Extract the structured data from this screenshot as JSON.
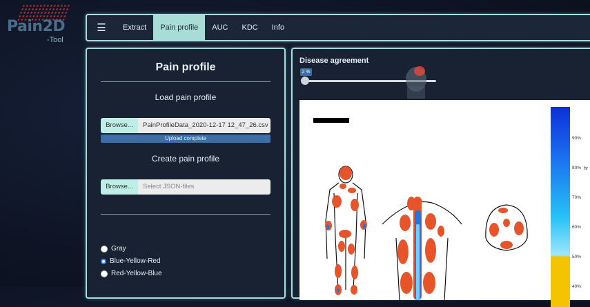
{
  "logo": {
    "title": "Pain2D",
    "subtitle": "-Tool"
  },
  "nav": {
    "burger_icon": "hamburger-icon",
    "items": [
      "Extract",
      "Pain profile",
      "AUC",
      "KDC",
      "Info"
    ],
    "active": "Pain profile"
  },
  "left_panel": {
    "title": "Pain profile",
    "load_heading": "Load pain profile",
    "load_browse": "Browse...",
    "load_file": "PainProfileData_2020-12-17 12_47_26.csv",
    "upload_status": "Upload complete",
    "upload_progress": 1.0,
    "create_heading": "Create pain profile",
    "create_browse": "Browse...",
    "create_placeholder": "Select JSON-files",
    "color_options": [
      "Gray",
      "Blue-Yellow-Red",
      "Red-Yellow-Blue"
    ],
    "color_selected": "Blue-Yellow-Red"
  },
  "right_panel": {
    "title": "Disease agreement",
    "slider_value": "2 %",
    "slider_fraction": 0.02,
    "colorbar_ticks": [
      "90%",
      "80%",
      "70%",
      "60%",
      "50%",
      "40%"
    ],
    "colorbar_label": "hr",
    "colors": {
      "red": "#e8542a",
      "orange": "#f07a30",
      "blue": "#2277dd",
      "yellow": "#f5c400"
    }
  }
}
